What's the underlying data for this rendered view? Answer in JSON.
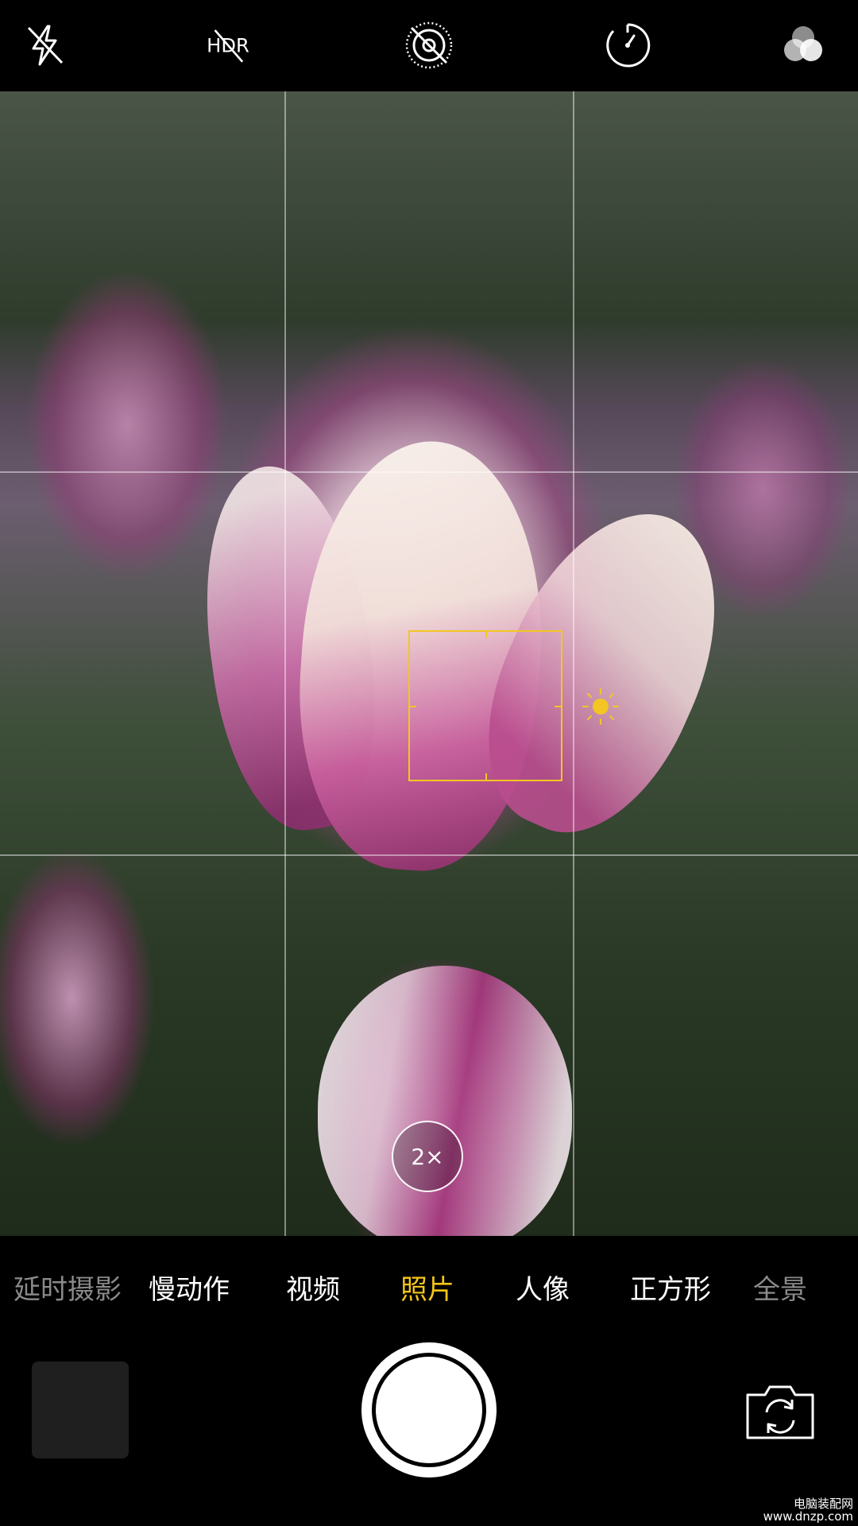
{
  "top_bar": {
    "flash_icon": "flash-off-icon",
    "hdr_label": "HDR",
    "live_icon": "live-photo-off-icon",
    "timer_icon": "timer-icon",
    "filters_icon": "filters-icon"
  },
  "viewfinder": {
    "zoom_label": "2×",
    "focus_color": "#f3c623"
  },
  "modes": {
    "items": [
      {
        "label": "延时摄影"
      },
      {
        "label": "慢动作"
      },
      {
        "label": "视频"
      },
      {
        "label": "照片"
      },
      {
        "label": "人像"
      },
      {
        "label": "正方形"
      },
      {
        "label": "全景"
      }
    ],
    "selected": "照片",
    "accent_color": "#f5c518"
  },
  "bottom": {
    "flip_icon": "switch-camera-icon"
  },
  "watermark": {
    "line1": "电脑装配网",
    "line2": "www.dnzp.com"
  }
}
